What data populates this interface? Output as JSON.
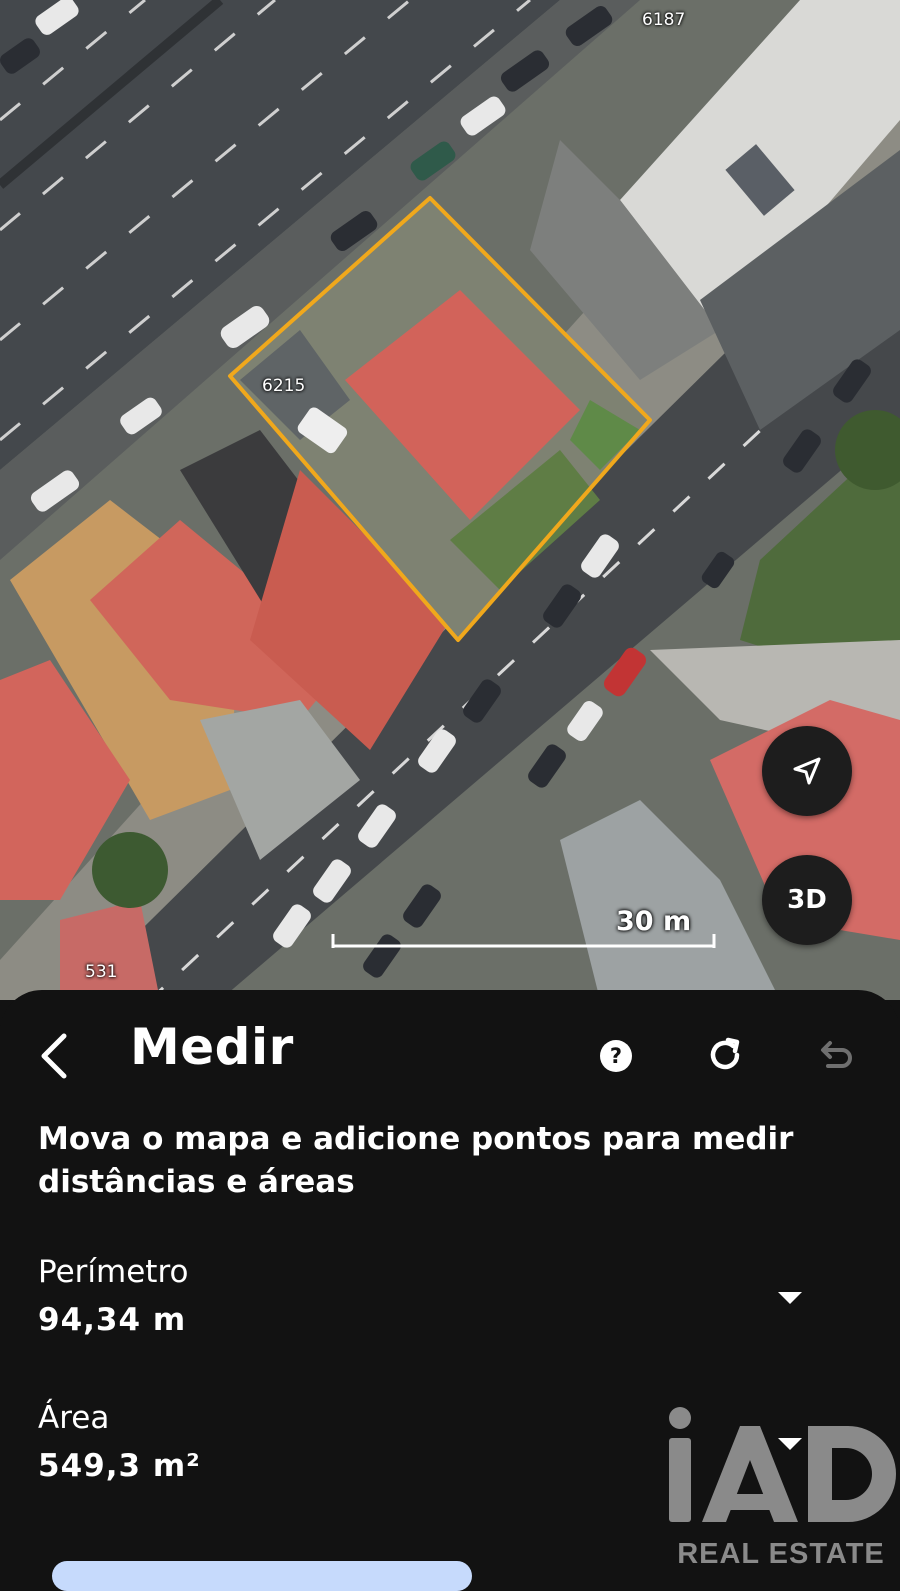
{
  "map": {
    "labels": {
      "top_right": "6187",
      "parcel": "6215",
      "bottom_left": "531"
    },
    "scale": "30 m",
    "locate_button": "navigation-arrow-icon",
    "three_d_label": "3D",
    "colors": {
      "outline": "#f0a81c",
      "roof": "#d2635a",
      "road": "#4a4d51"
    }
  },
  "panel": {
    "title": "Medir",
    "back_icon": "chevron-left-icon",
    "help_icon": "help-icon",
    "refresh_icon": "refresh-icon",
    "undo_icon": "undo-icon",
    "instruction": "Mova o mapa e adicione pontos para medir distâncias e áreas",
    "perimeter": {
      "label": "Perímetro",
      "value": "94,34 m"
    },
    "area": {
      "label": "Área",
      "value": "549,3 m²"
    }
  },
  "watermark": {
    "logo": "iAD",
    "tagline": "REAL ESTATE",
    "color": "#8a8a8a"
  }
}
